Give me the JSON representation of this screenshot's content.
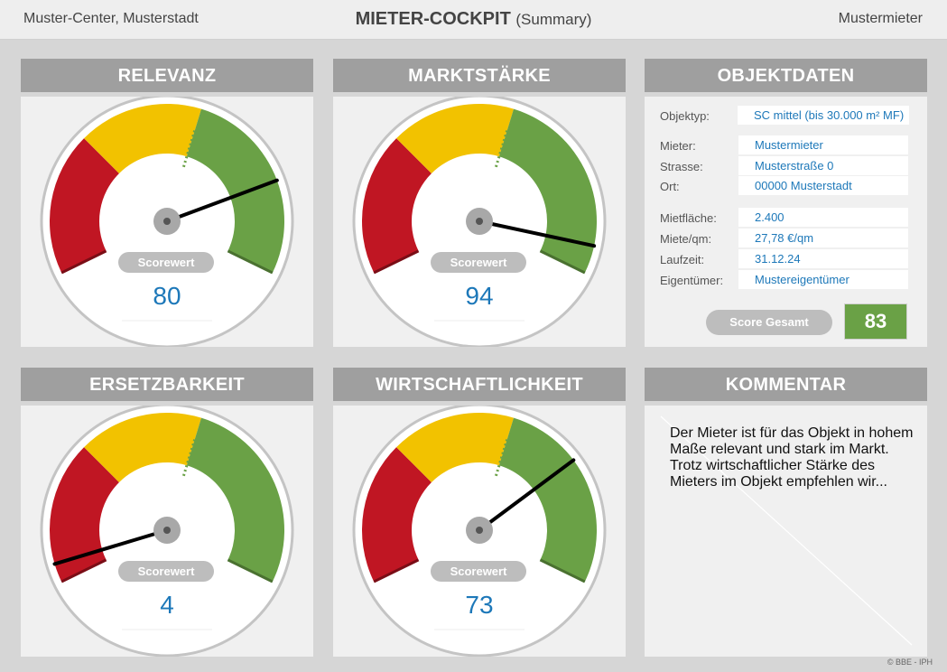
{
  "header": {
    "left": "Muster-Center, Musterstadt",
    "title": "MIETER-COCKPIT",
    "subtitle": "(Summary)",
    "right": "Mustermieter"
  },
  "gauges": [
    {
      "title": "RELEVANZ",
      "score_label": "Scorewert",
      "value": "80",
      "needle_fraction": 0.8
    },
    {
      "title": "MARKTSTÄRKE",
      "score_label": "Scorewert",
      "value": "94",
      "needle_fraction": 0.94
    },
    {
      "title": "ERSETZBARKEIT",
      "score_label": "Scorewert",
      "value": "4",
      "needle_fraction": 0.04
    },
    {
      "title": "WIRTSCHAFTLICHKEIT",
      "score_label": "Scorewert",
      "value": "73",
      "needle_fraction": 0.73
    }
  ],
  "objektdaten": {
    "title": "OBJEKTDATEN",
    "objekttyp_label": "Objektyp:",
    "objekttyp_value": "SC mittel (bis 30.000 m² MF)",
    "mieter_label": "Mieter:",
    "mieter_value": "Mustermieter",
    "strasse_label": "Strasse:",
    "strasse_value": "Musterstraße 0",
    "ort_label": "Ort:",
    "ort_value": "00000 Musterstadt",
    "mietflaeche_label": "Mietfläche:",
    "mietflaeche_value": "2.400",
    "miete_label": "Miete/qm:",
    "miete_value": "27,78 €/qm",
    "laufzeit_label": "Laufzeit:",
    "laufzeit_value": "31.12.24",
    "eigentuemer_label": "Eigentümer:",
    "eigentuemer_value": "Mustereigentümer",
    "score_gesamt_label": "Score Gesamt",
    "score_gesamt_value": "83"
  },
  "kommentar": {
    "title": "KOMMENTAR",
    "text": "Der Mieter ist für das Objekt in hohem Maße relevant und stark im Markt. Trotz wirtschaftlicher Stärke des Mieters im Objekt empfehlen wir..."
  },
  "footer": {
    "copyright": "© BBE - IPH"
  },
  "colors": {
    "red": "#c01623",
    "yellow": "#f2c200",
    "green": "#6aa146",
    "value_blue": "#1d78b9",
    "header_gray": "#9f9f9f"
  }
}
